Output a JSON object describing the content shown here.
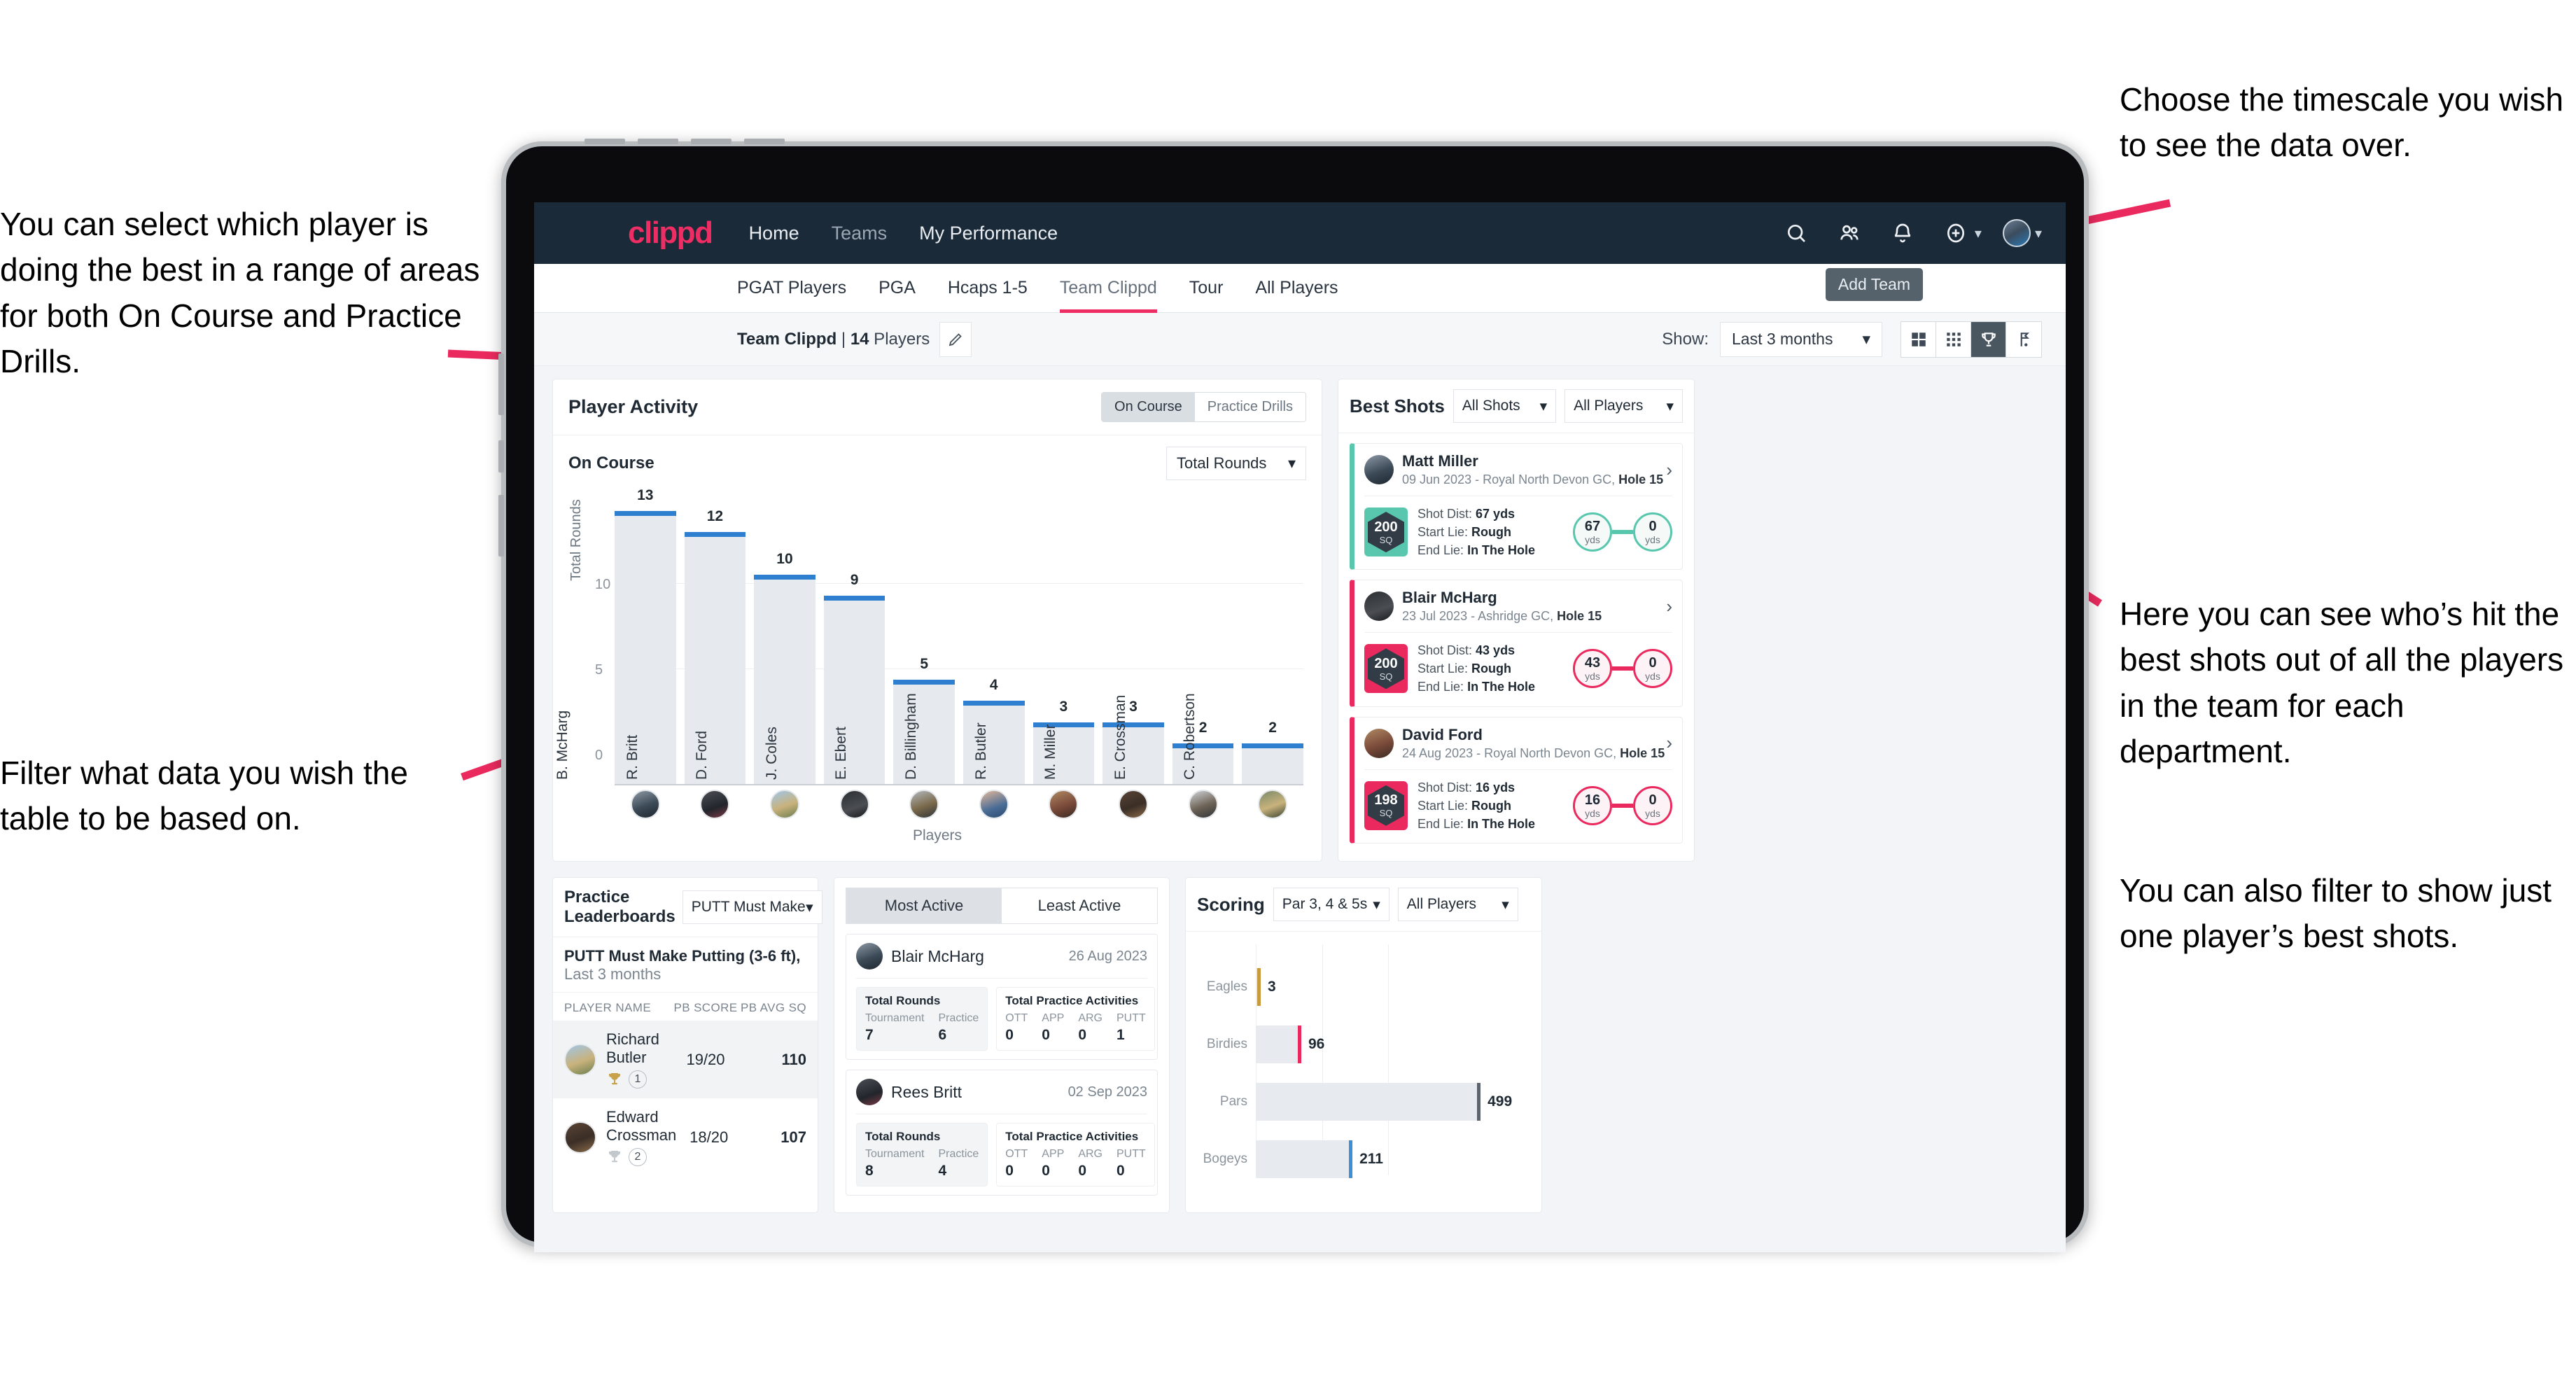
{
  "annotations": {
    "left_top": "You can select which player is doing the best in a range of areas for both On Course and Practice Drills.",
    "left_bottom": "Filter what data you wish the table to be based on.",
    "right_top": "Choose the timescale you wish to see the data over.",
    "right_mid": "Here you can see who’s hit the best shots out of all the players in the team for each department.",
    "right_bottom": "You can also filter to show just one player’s best shots."
  },
  "topnav": {
    "logo": "clippd",
    "links": [
      {
        "label": "Home"
      },
      {
        "label": "Teams"
      },
      {
        "label": "My Performance"
      }
    ],
    "icons": [
      "search-icon",
      "people-icon",
      "bell-icon",
      "plus-circle-icon",
      "avatar"
    ]
  },
  "tabs": [
    {
      "label": "PGAT Players",
      "active": false
    },
    {
      "label": "PGA",
      "active": false
    },
    {
      "label": "Hcaps 1-5",
      "active": false
    },
    {
      "label": "Team Clippd",
      "active": true
    },
    {
      "label": "Tour",
      "active": false
    },
    {
      "label": "All Players",
      "active": false
    }
  ],
  "tooltip": {
    "add_team": "Add Team"
  },
  "subheader": {
    "team_name": "Team Clippd",
    "separator": " | ",
    "player_count": "14",
    "players_word": " Players",
    "show_label": "Show:",
    "timescale_value": "Last 3 months",
    "view_buttons": [
      "grid-large-icon",
      "grid-small-icon",
      "trophy-icon",
      "flag-icon"
    ],
    "active_view": "trophy-icon"
  },
  "activity": {
    "title": "Player Activity",
    "segments": [
      {
        "label": "On Course",
        "active": true
      },
      {
        "label": "Practice Drills",
        "active": false
      }
    ],
    "section_label": "On Course",
    "metric_select": "Total Rounds"
  },
  "chart_data": {
    "type": "bar",
    "title": "Player Activity - On Course",
    "xlabel": "Players",
    "ylabel": "Total Rounds",
    "ylim": [
      0,
      14
    ],
    "yticks": [
      "0",
      "5",
      "10"
    ],
    "grid": true,
    "categories": [
      "B. McHarg",
      "R. Britt",
      "D. Ford",
      "J. Coles",
      "E. Ebert",
      "D. Billingham",
      "R. Butler",
      "M. Miller",
      "E. Crossman",
      "C. Robertson"
    ],
    "values": [
      13,
      12,
      10,
      9,
      5,
      4,
      3,
      3,
      2,
      2
    ]
  },
  "best_shots": {
    "title": "Best Shots",
    "shot_filter": "All Shots",
    "player_filter": "All Players",
    "cards": [
      {
        "name": "Matt Miller",
        "meta_date": "09 Jun 2023 - Royal North Devon GC, ",
        "meta_hole": "Hole 15",
        "sq": "200",
        "sq_unit": "SQ",
        "accent": "#58c7ad",
        "shot_dist_label": "Shot Dist: ",
        "shot_dist": "67 yds",
        "start_lie_label": "Start Lie: ",
        "start_lie": "Rough",
        "end_lie_label": "End Lie: ",
        "end_lie": "In The Hole",
        "from_val": "67",
        "from_unit": "yds",
        "to_val": "0",
        "to_unit": "yds"
      },
      {
        "name": "Blair McHarg",
        "meta_date": "23 Jul 2023 - Ashridge GC, ",
        "meta_hole": "Hole 15",
        "sq": "200",
        "sq_unit": "SQ",
        "accent": "#ea2a5e",
        "shot_dist_label": "Shot Dist: ",
        "shot_dist": "43 yds",
        "start_lie_label": "Start Lie: ",
        "start_lie": "Rough",
        "end_lie_label": "End Lie: ",
        "end_lie": "In The Hole",
        "from_val": "43",
        "from_unit": "yds",
        "to_val": "0",
        "to_unit": "yds"
      },
      {
        "name": "David Ford",
        "meta_date": "24 Aug 2023 - Royal North Devon GC, ",
        "meta_hole": "Hole 15",
        "sq": "198",
        "sq_unit": "SQ",
        "accent": "#ea2a5e",
        "shot_dist_label": "Shot Dist: ",
        "shot_dist": "16 yds",
        "start_lie_label": "Start Lie: ",
        "start_lie": "Rough",
        "end_lie_label": "End Lie: ",
        "end_lie": "In The Hole",
        "from_val": "16",
        "from_unit": "yds",
        "to_val": "0",
        "to_unit": "yds"
      }
    ]
  },
  "practice": {
    "title": "Practice Leaderboards",
    "drill_select": "PUTT Must Make Putting ...",
    "subtitle_bold": "PUTT Must Make Putting (3-6 ft),",
    "subtitle_rest": " Last 3 months",
    "columns": [
      "PLAYER NAME",
      "PB SCORE",
      "PB AVG SQ"
    ],
    "rows": [
      {
        "name": "Richard Butler",
        "rank": "1",
        "trophy": "gold",
        "pb_score": "19/20",
        "pb_avg_sq": "110"
      },
      {
        "name": "Edward Crossman",
        "rank": "2",
        "trophy": "silver",
        "pb_score": "18/20",
        "pb_avg_sq": "107"
      }
    ]
  },
  "activity_panel": {
    "tabs": [
      {
        "label": "Most Active",
        "active": true
      },
      {
        "label": "Least Active",
        "active": false
      }
    ],
    "rounds_title": "Total Rounds",
    "practice_title": "Total Practice Activities",
    "rounds_keys": [
      "Tournament",
      "Practice"
    ],
    "practice_keys": [
      "OTT",
      "APP",
      "ARG",
      "PUTT"
    ],
    "cards": [
      {
        "name": "Blair McHarg",
        "date": "26 Aug 2023",
        "rounds": [
          "7",
          "6"
        ],
        "practice": [
          "0",
          "0",
          "0",
          "1"
        ]
      },
      {
        "name": "Rees Britt",
        "date": "02 Sep 2023",
        "rounds": [
          "8",
          "4"
        ],
        "practice": [
          "0",
          "0",
          "0",
          "0"
        ]
      }
    ]
  },
  "scoring": {
    "title": "Scoring",
    "par_filter": "Par 3, 4 & 5s",
    "player_filter": "All Players"
  },
  "scoring_chart": {
    "type": "bar",
    "orientation": "horizontal",
    "title": "Scoring",
    "categories": [
      "Eagles",
      "Birdies",
      "Pars",
      "Bogeys"
    ],
    "values": [
      3,
      96,
      499,
      211
    ],
    "colors": [
      "#c79a3d",
      "#ea2a5e",
      "#5b646d",
      "#3f8fd4"
    ],
    "xlim": [
      0,
      600
    ],
    "grid": true
  },
  "colors": {
    "brand_pink": "#ed2d63",
    "nav_dark": "#1b2a38",
    "bar_blue": "#2f7fd0",
    "teal": "#58c7ad"
  }
}
